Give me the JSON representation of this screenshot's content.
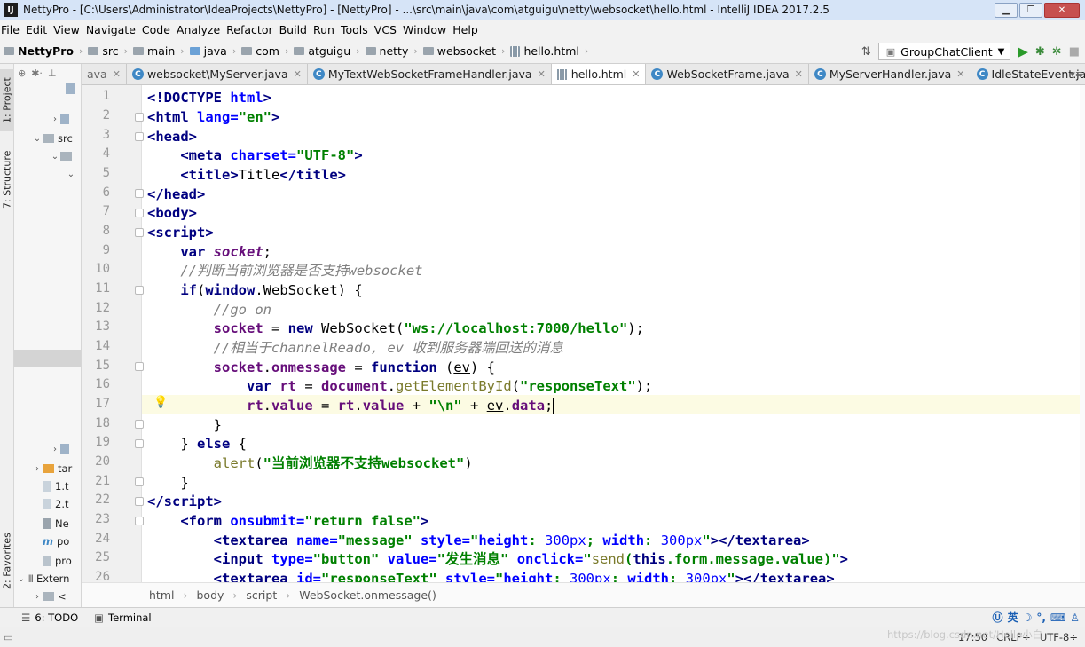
{
  "window": {
    "title": "NettyPro - [C:\\Users\\Administrator\\IdeaProjects\\NettyPro] - [NettyPro] - ...\\src\\main\\java\\com\\atguigu\\netty\\websocket\\hello.html - IntelliJ IDEA 2017.2.5",
    "app_icon": "IJ"
  },
  "menu": [
    "File",
    "Edit",
    "View",
    "Navigate",
    "Code",
    "Analyze",
    "Refactor",
    "Build",
    "Run",
    "Tools",
    "VCS",
    "Window",
    "Help"
  ],
  "breadcrumb": [
    "NettyPro",
    "src",
    "main",
    "java",
    "com",
    "atguigu",
    "netty",
    "websocket",
    "hello.html"
  ],
  "run_config": "GroupChatClient",
  "tabs": [
    {
      "label": "ava",
      "type": "partial"
    },
    {
      "label": "websocket\\MyServer.java",
      "type": "class"
    },
    {
      "label": "MyTextWebSocketFrameHandler.java",
      "type": "class"
    },
    {
      "label": "hello.html",
      "type": "html",
      "active": true
    },
    {
      "label": "WebSocketFrame.java",
      "type": "class"
    },
    {
      "label": "MyServerHandler.java",
      "type": "class"
    },
    {
      "label": "IdleStateEvent.java",
      "type": "class"
    }
  ],
  "side_tabs": {
    "project": "1: Project",
    "structure": "7: Structure",
    "favorites": "2: Favorites"
  },
  "project_tree": [
    {
      "label": "src",
      "kind": "folder",
      "arrow": "⌄"
    },
    {
      "label": "tar",
      "kind": "folder-orange",
      "arrow": "›"
    },
    {
      "label": "1.t",
      "kind": "file"
    },
    {
      "label": "2.t",
      "kind": "file"
    },
    {
      "label": "Ne",
      "kind": "file"
    },
    {
      "label": "po",
      "kind": "file"
    },
    {
      "label": "pro",
      "kind": "file"
    },
    {
      "label": "Extern",
      "kind": "lib",
      "arrow": "⌄"
    },
    {
      "label": "<",
      "kind": "lib",
      "arrow": "›"
    }
  ],
  "code": {
    "line_numbers": [
      "1",
      "2",
      "3",
      "4",
      "5",
      "6",
      "7",
      "8",
      "9",
      "10",
      "11",
      "12",
      "13",
      "14",
      "15",
      "16",
      "17",
      "18",
      "19",
      "20",
      "21",
      "22",
      "23",
      "24",
      "25",
      "26"
    ],
    "l13_str": "\"ws://localhost:7000/hello\"",
    "l16_str": "\"responseText\"",
    "l20_str": "\"当前浏览器不支持websocket\""
  },
  "editor_breadcrumb": [
    "html",
    "body",
    "script",
    "WebSocket.onmessage()"
  ],
  "bottom_tools": [
    {
      "label": "6: TODO"
    },
    {
      "label": "Terminal"
    }
  ],
  "ime": {
    "lang": "英"
  },
  "status": {
    "position": "17:50",
    "line_sep": "CRLF÷",
    "encoding": "UTF-8÷"
  },
  "watermark": "https://blog.csdn.net/Hello小白"
}
